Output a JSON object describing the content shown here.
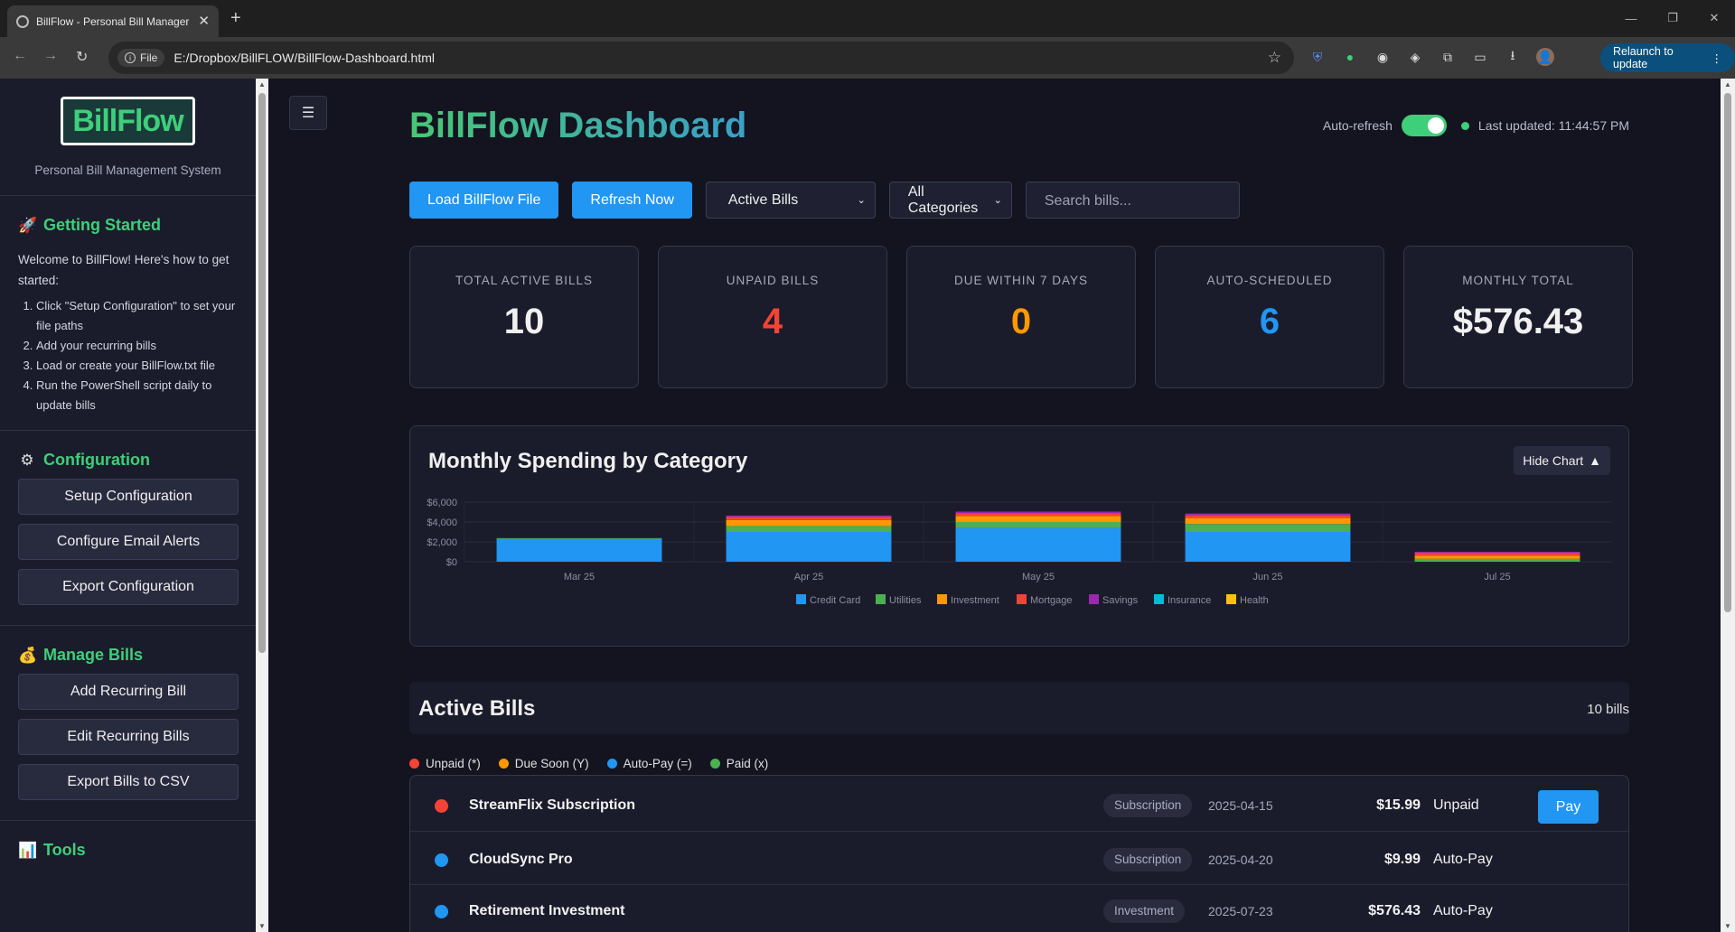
{
  "browser": {
    "tab_title": "BillFlow - Personal Bill Manager",
    "new_tab": "+",
    "url_chip": "File",
    "url": "E:/Dropbox/BillFLOW/BillFlow-Dashboard.html",
    "relaunch": "Relaunch to update"
  },
  "sidebar": {
    "logo": "BillFlow",
    "subtitle": "Personal Bill Management System",
    "getting_started": {
      "title": "Getting Started",
      "intro": "Welcome to BillFlow! Here's how to get started:",
      "steps": [
        "Click \"Setup Configuration\" to set your file paths",
        "Add your recurring bills",
        "Load or create your BillFlow.txt file",
        "Run the PowerShell script daily to update bills"
      ]
    },
    "configuration": {
      "title": "Configuration",
      "buttons": [
        "Setup Configuration",
        "Configure Email Alerts",
        "Export Configuration"
      ]
    },
    "manage": {
      "title": "Manage Bills",
      "buttons": [
        "Add Recurring Bill",
        "Edit Recurring Bills",
        "Export Bills to CSV"
      ]
    },
    "tools": {
      "title": "Tools"
    }
  },
  "header": {
    "title": "BillFlow Dashboard",
    "auto_refresh": "Auto-refresh",
    "last_updated": "Last updated: 11:44:57 PM"
  },
  "controls": {
    "load": "Load BillFlow File",
    "refresh": "Refresh Now",
    "filter": "Active Bills",
    "category": "All Categories",
    "search_placeholder": "Search bills..."
  },
  "stats": [
    {
      "label": "Total Active Bills",
      "value": "10",
      "color": "#f0f0f0"
    },
    {
      "label": "Unpaid Bills",
      "value": "4",
      "color": "#f44336"
    },
    {
      "label": "Due Within 7 Days",
      "value": "0",
      "color": "#ff9800"
    },
    {
      "label": "Auto-Scheduled",
      "value": "6",
      "color": "#2196f3"
    },
    {
      "label": "Monthly Total",
      "value": "$576.43",
      "color": "#f0f0f0"
    }
  ],
  "chart": {
    "title": "Monthly Spending by Category",
    "hide_button": "Hide Chart"
  },
  "chart_data": {
    "type": "bar",
    "stacked": true,
    "title": "Monthly Spending by Category",
    "categories": [
      "Mar 25",
      "Apr 25",
      "May 25",
      "Jun 25",
      "Jul 25"
    ],
    "y_ticks": [
      "$0",
      "$2,000",
      "$4,000",
      "$6,000"
    ],
    "ylim": [
      0,
      6000
    ],
    "legend_position": "bottom",
    "series": [
      {
        "name": "Credit Card",
        "color": "#2196f3",
        "values": [
          2300,
          3000,
          3400,
          3000,
          0
        ]
      },
      {
        "name": "Utilities",
        "color": "#4caf50",
        "values": [
          80,
          600,
          600,
          800,
          300
        ]
      },
      {
        "name": "Investment",
        "color": "#ff9800",
        "values": [
          0,
          600,
          600,
          600,
          300
        ]
      },
      {
        "name": "Mortgage",
        "color": "#f44336",
        "values": [
          0,
          300,
          300,
          300,
          300
        ]
      },
      {
        "name": "Savings",
        "color": "#9c27b0",
        "values": [
          0,
          150,
          150,
          150,
          100
        ]
      },
      {
        "name": "Insurance",
        "color": "#00bcd4",
        "values": [
          0,
          0,
          0,
          0,
          0
        ]
      },
      {
        "name": "Health",
        "color": "#ffc107",
        "values": [
          0,
          0,
          0,
          0,
          0
        ]
      }
    ]
  },
  "bills": {
    "title": "Active Bills",
    "count": "10 bills",
    "legend": [
      {
        "label": "Unpaid (*)",
        "color": "#f44336"
      },
      {
        "label": "Due Soon (Y)",
        "color": "#ff9800"
      },
      {
        "label": "Auto-Pay (=)",
        "color": "#2196f3"
      },
      {
        "label": "Paid (x)",
        "color": "#4caf50"
      }
    ],
    "rows": [
      {
        "name": "StreamFlix Subscription",
        "category": "Subscription",
        "date": "2025-04-15",
        "amount": "$15.99",
        "status": "Unpaid",
        "dot": "#f44336",
        "action": "Pay"
      },
      {
        "name": "CloudSync Pro",
        "category": "Subscription",
        "date": "2025-04-20",
        "amount": "$9.99",
        "status": "Auto-Pay",
        "dot": "#2196f3"
      },
      {
        "name": "Retirement Investment",
        "category": "Investment",
        "date": "2025-07-23",
        "amount": "$576.43",
        "status": "Auto-Pay",
        "dot": "#2196f3"
      }
    ]
  }
}
